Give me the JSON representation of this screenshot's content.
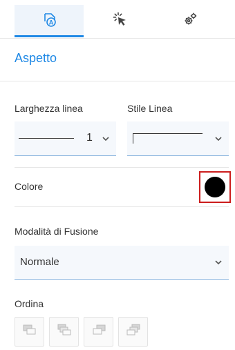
{
  "tabs": [
    {
      "icon": "appearance-icon",
      "active": true
    },
    {
      "icon": "click-cursor-icon",
      "active": false
    },
    {
      "icon": "gears-icon",
      "active": false
    }
  ],
  "section_title": "Aspetto",
  "line_width": {
    "label": "Larghezza linea",
    "value": "1"
  },
  "line_style": {
    "label": "Stile Linea"
  },
  "color": {
    "label": "Colore",
    "value": "#000000"
  },
  "blend_mode": {
    "label": "Modalità di Fusione",
    "value": "Normale"
  },
  "order": {
    "label": "Ordina",
    "buttons": [
      "bring-forward-icon",
      "bring-to-front-icon",
      "send-backward-icon",
      "send-to-back-icon"
    ]
  },
  "colors": {
    "accent": "#1e88e5",
    "highlight": "#cc1d1d"
  }
}
